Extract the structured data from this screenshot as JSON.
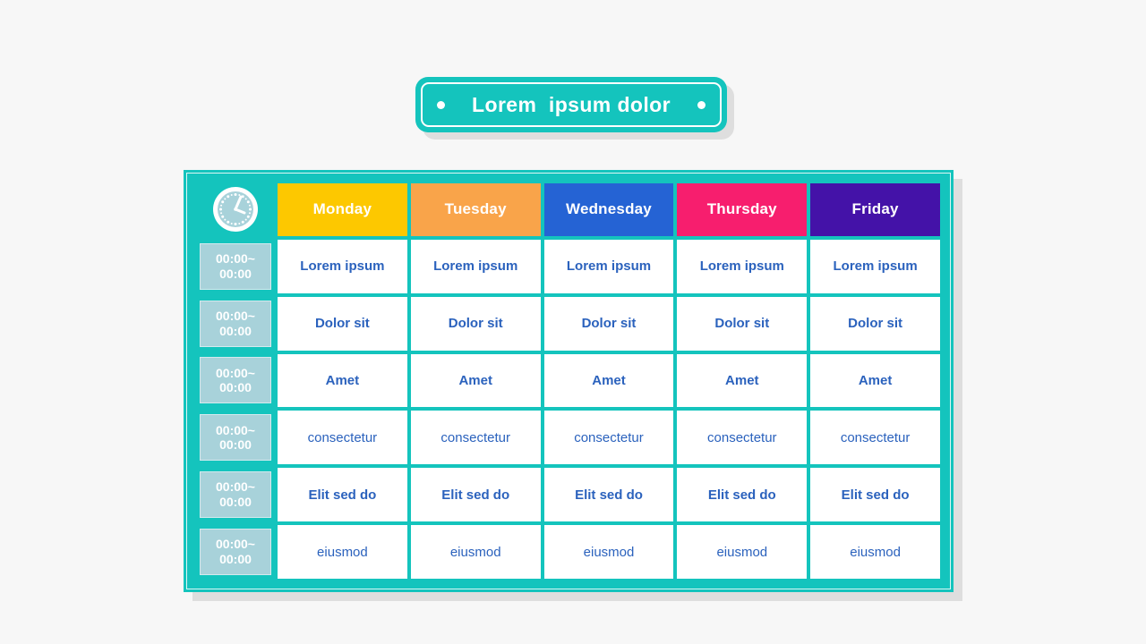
{
  "page": {
    "background_color": "#f7f7f7"
  },
  "banner": {
    "title": "Lorem  ipsum dolor",
    "fill_color": "#14c4bd",
    "border_color": "#ffffff",
    "shadow_color": "#dedede",
    "left_dot": "dot",
    "right_dot": "dot"
  },
  "table": {
    "frame_color": "#14c4bd",
    "shadow_color": "#dedede",
    "clock_icon": "clock-icon",
    "time_cell_bg": "#a8d2da",
    "cell_text_color": "#2b62bd",
    "columns": [
      {
        "label": "Monday",
        "color": "#fdc800"
      },
      {
        "label": "Tuesday",
        "color": "#f9a44a"
      },
      {
        "label": "Wednesday",
        "color": "#2563d4"
      },
      {
        "label": "Thursday",
        "color": "#f71e6e"
      },
      {
        "label": "Friday",
        "color": "#4412a8"
      }
    ],
    "rows": [
      {
        "time_start": "00:00~",
        "time_end": "00:00",
        "weight": "bold",
        "cells": [
          "Lorem ipsum",
          "Lorem ipsum",
          "Lorem ipsum",
          "Lorem ipsum",
          "Lorem ipsum"
        ]
      },
      {
        "time_start": "00:00~",
        "time_end": "00:00",
        "weight": "bold",
        "cells": [
          "Dolor sit",
          "Dolor sit",
          "Dolor sit",
          "Dolor sit",
          "Dolor sit"
        ]
      },
      {
        "time_start": "00:00~",
        "time_end": "00:00",
        "weight": "bold",
        "cells": [
          "Amet",
          "Amet",
          "Amet",
          "Amet",
          "Amet"
        ]
      },
      {
        "time_start": "00:00~",
        "time_end": "00:00",
        "weight": "regular",
        "cells": [
          "consectetur",
          "consectetur",
          "consectetur",
          "consectetur",
          "consectetur"
        ]
      },
      {
        "time_start": "00:00~",
        "time_end": "00:00",
        "weight": "bold",
        "cells": [
          "Elit sed do",
          "Elit sed do",
          "Elit sed do",
          "Elit sed do",
          "Elit sed do"
        ]
      },
      {
        "time_start": "00:00~",
        "time_end": "00:00",
        "weight": "regular",
        "cells": [
          "eiusmod",
          "eiusmod",
          "eiusmod",
          "eiusmod",
          "eiusmod"
        ]
      }
    ]
  }
}
